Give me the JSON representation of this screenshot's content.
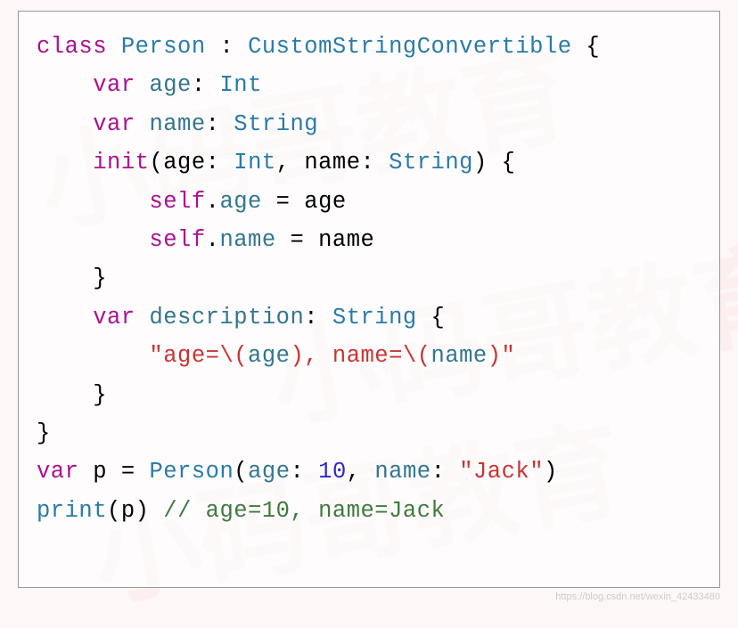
{
  "code": {
    "line1": {
      "kw1": "class",
      "sp1": " ",
      "type1": "Person",
      "sp2": " : ",
      "type2": "CustomStringConvertible",
      "sp3": " {"
    },
    "line2": {
      "indent": "    ",
      "kw1": "var",
      "sp1": " ",
      "prop1": "age",
      "sp2": ": ",
      "type1": "Int"
    },
    "line3": {
      "indent": "    ",
      "kw1": "var",
      "sp1": " ",
      "prop1": "name",
      "sp2": ": ",
      "type1": "String"
    },
    "line4": {
      "indent": "    ",
      "kw1": "init",
      "paren1": "(",
      "arg1": "age",
      "colon1": ": ",
      "type1": "Int",
      "comma": ", ",
      "arg2": "name",
      "colon2": ": ",
      "type2": "String",
      "paren2": ")",
      "brace": " {"
    },
    "line5": {
      "indent": "        ",
      "kw1": "self",
      "dot": ".",
      "prop1": "age",
      "eq": " = ",
      "var1": "age"
    },
    "line6": {
      "indent": "        ",
      "kw1": "self",
      "dot": ".",
      "prop1": "name",
      "eq": " = ",
      "var1": "name"
    },
    "line7": {
      "indent": "    ",
      "brace": "}"
    },
    "line8": {
      "indent": "    ",
      "kw1": "var",
      "sp1": " ",
      "prop1": "description",
      "sp2": ": ",
      "type1": "String",
      "brace": " {"
    },
    "line9": {
      "indent": "        ",
      "str1": "\"age=",
      "esc1": "\\(",
      "prop1": "age",
      "esc2": ")",
      "str2": ", name=",
      "esc3": "\\(",
      "prop2": "name",
      "esc4": ")",
      "str3": "\""
    },
    "line10": {
      "indent": "    ",
      "brace": "}"
    },
    "line11": {
      "brace": "}"
    },
    "line12": {
      "kw1": "var",
      "sp1": " ",
      "var1": "p",
      "eq": " = ",
      "type1": "Person",
      "paren1": "(",
      "arg1": "age",
      "colon1": ": ",
      "num1": "10",
      "comma": ", ",
      "arg2": "name",
      "colon2": ": ",
      "str1": "\"Jack\"",
      "paren2": ")"
    },
    "line13": {
      "fn1": "print",
      "paren1": "(",
      "var1": "p",
      "paren2": ")",
      "sp1": " ",
      "comment1": "// age=10, name=Jack"
    }
  },
  "footer": "https://blog.csdn.net/wexin_42433480"
}
